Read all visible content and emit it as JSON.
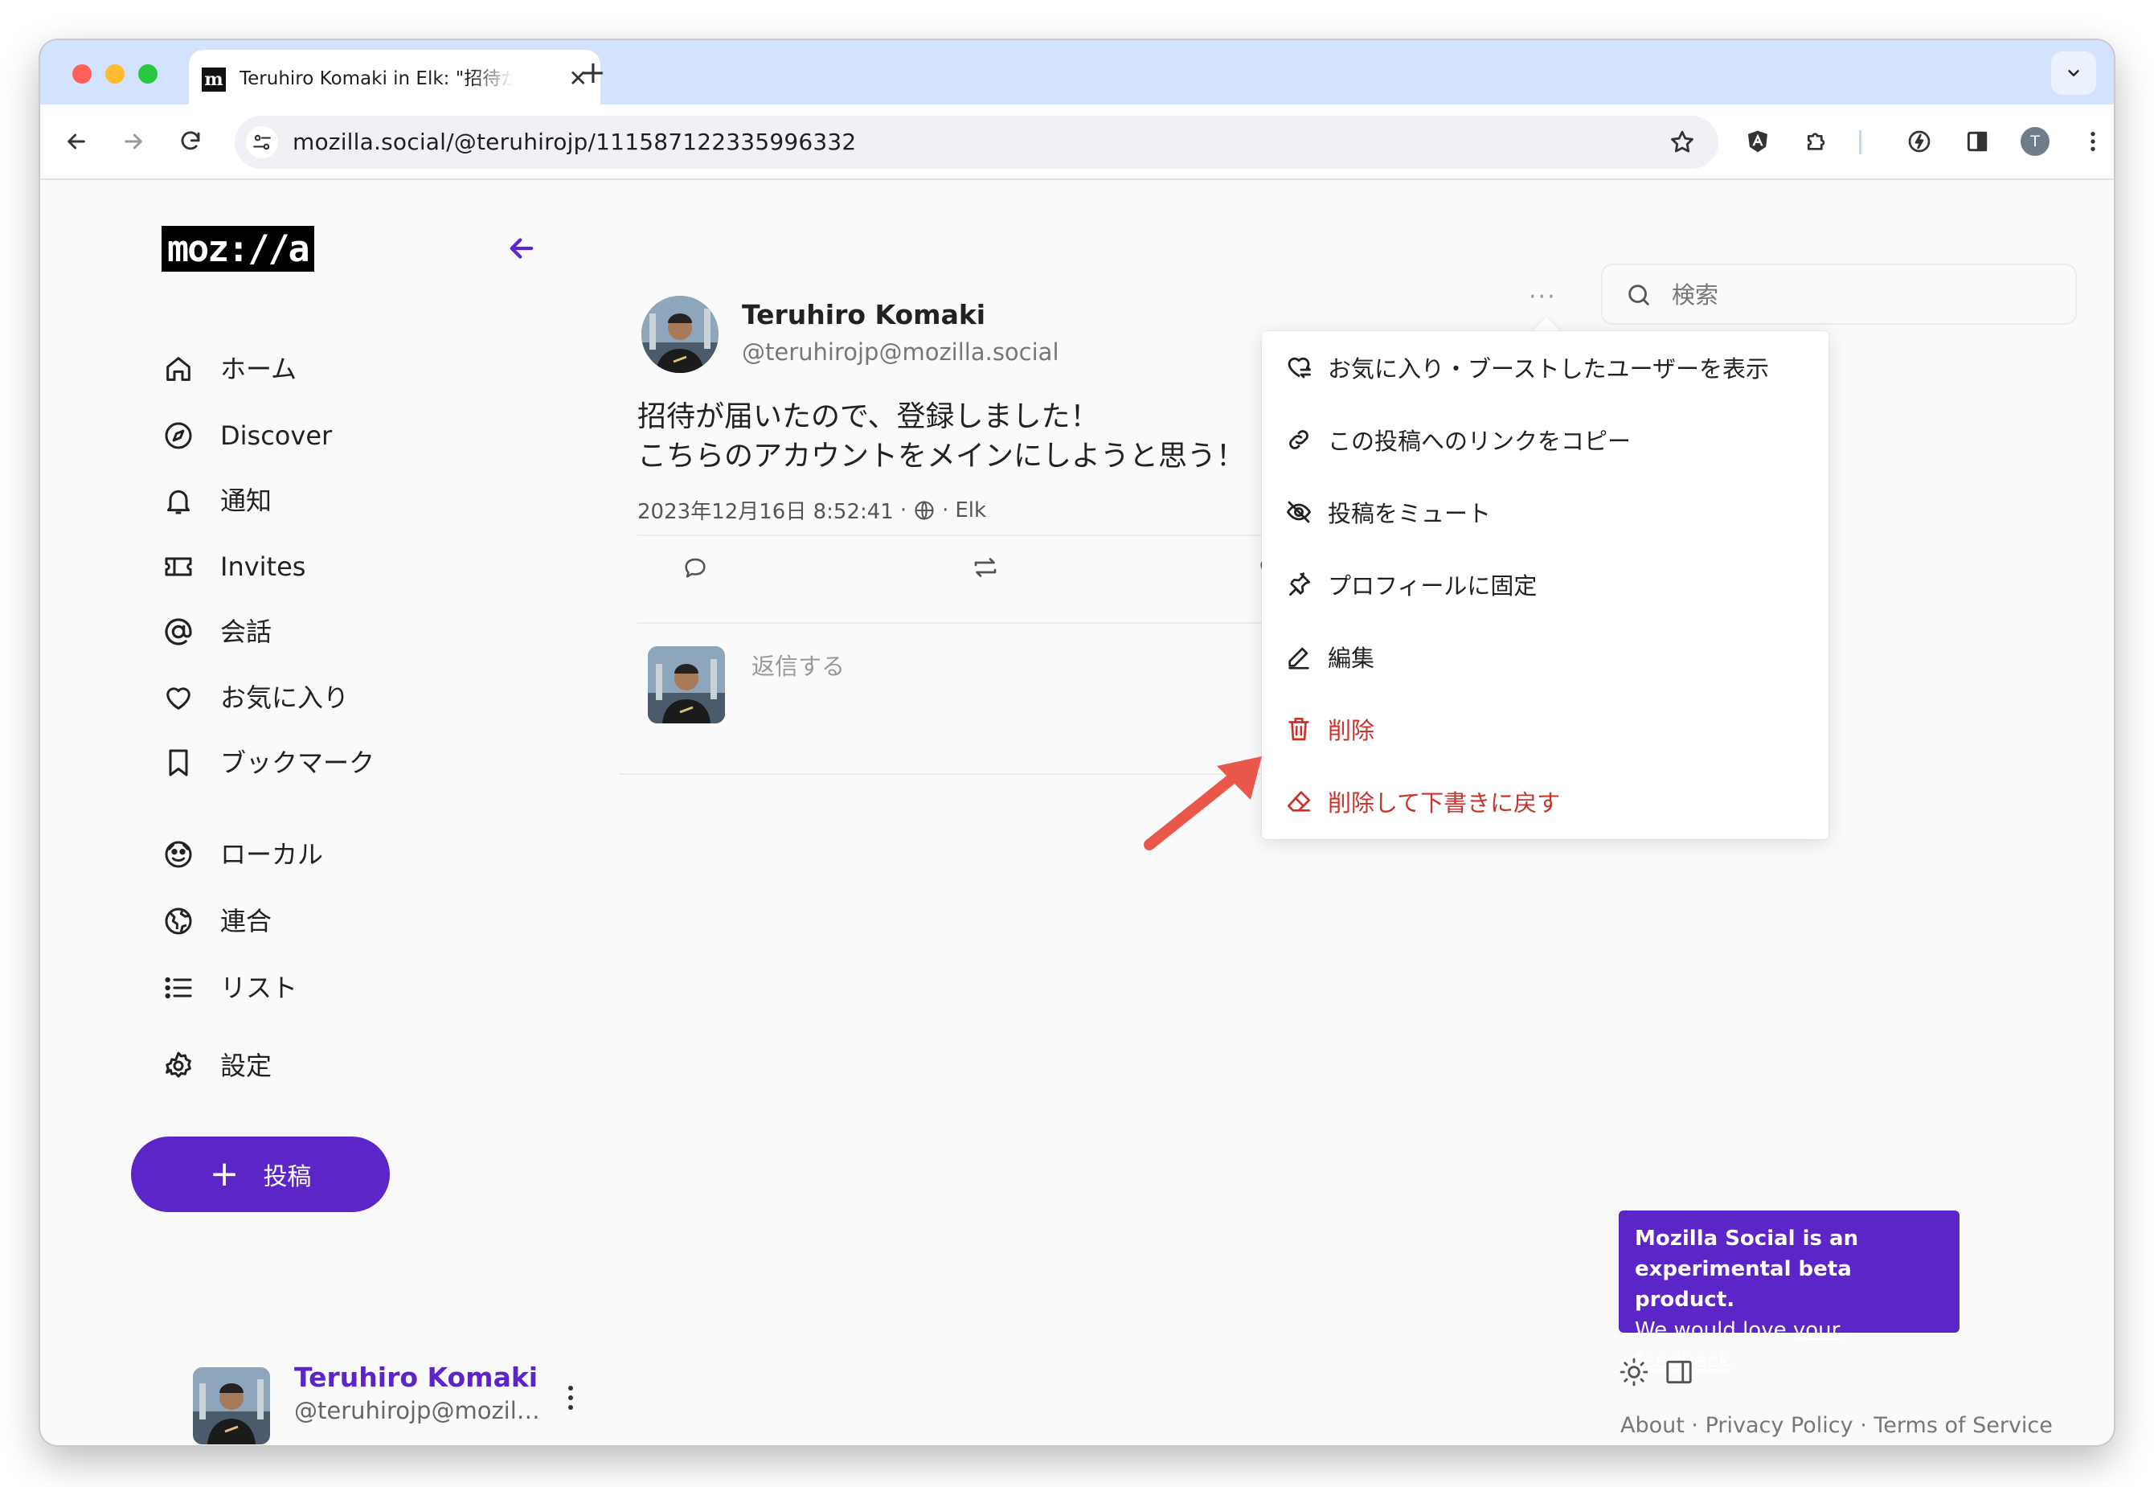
{
  "browser": {
    "tab_title": "Teruhiro Komaki in Elk: \"招待が届いたので、登録しました！",
    "favicon_letter": "m",
    "url": "mozilla.social/@teruhirojp/111587122335996332",
    "profile_initial": "T"
  },
  "sidebar": {
    "logo": "moz://a",
    "items": [
      {
        "label": "ホーム",
        "icon": "home-icon"
      },
      {
        "label": "Discover",
        "icon": "compass-icon"
      },
      {
        "label": "通知",
        "icon": "bell-icon"
      },
      {
        "label": "Invites",
        "icon": "ticket-icon"
      },
      {
        "label": "会話",
        "icon": "at-icon"
      },
      {
        "label": "お気に入り",
        "icon": "heart-icon"
      },
      {
        "label": "ブックマーク",
        "icon": "bookmark-icon"
      },
      {
        "label": "ローカル",
        "icon": "local-icon"
      },
      {
        "label": "連合",
        "icon": "globe-icon"
      },
      {
        "label": "リスト",
        "icon": "list-icon"
      },
      {
        "label": "設定",
        "icon": "gear-icon"
      }
    ],
    "compose_label": "投稿",
    "current_user": {
      "name": "Teruhiro Komaki",
      "handle": "@teruhirojp@mozilla..."
    }
  },
  "status": {
    "author_name": "Teruhiro Komaki",
    "author_handle": "@teruhirojp@mozilla.social",
    "body_line1": "招待が届いたので、登録しました！",
    "body_line2": "こちらのアカウントをメインにしようと思う！",
    "timestamp": "2023年12月16日 8:52:41",
    "client": "Elk",
    "reply_placeholder": "返信する"
  },
  "menu": {
    "items": [
      {
        "label": "お気に入り・ブーストしたユーザーを表示",
        "icon": "heart-repeat-icon",
        "danger": false
      },
      {
        "label": "この投稿へのリンクをコピー",
        "icon": "link-icon",
        "danger": false
      },
      {
        "label": "投稿をミュート",
        "icon": "eye-off-icon",
        "danger": false
      },
      {
        "label": "プロフィールに固定",
        "icon": "pin-icon",
        "danger": false
      },
      {
        "label": "編集",
        "icon": "pencil-icon",
        "danger": false
      },
      {
        "label": "削除",
        "icon": "trash-icon",
        "danger": true
      },
      {
        "label": "削除して下書きに戻す",
        "icon": "eraser-icon",
        "danger": true
      }
    ]
  },
  "search": {
    "placeholder": "検索"
  },
  "beta_notice": {
    "line1": "Mozilla Social is an",
    "line2": "experimental beta product.",
    "line3_prefix": "We would love ",
    "line3_link": "your feedback",
    "line3_suffix": "."
  },
  "footer": {
    "about": "About",
    "privacy": "Privacy Policy",
    "terms": "Terms of Service",
    "separator": "·"
  },
  "colors": {
    "accent": "#5b25c8",
    "danger": "#c9332b",
    "tabstrip": "#d3e3fd",
    "annotation_arrow": "#e8574a"
  }
}
